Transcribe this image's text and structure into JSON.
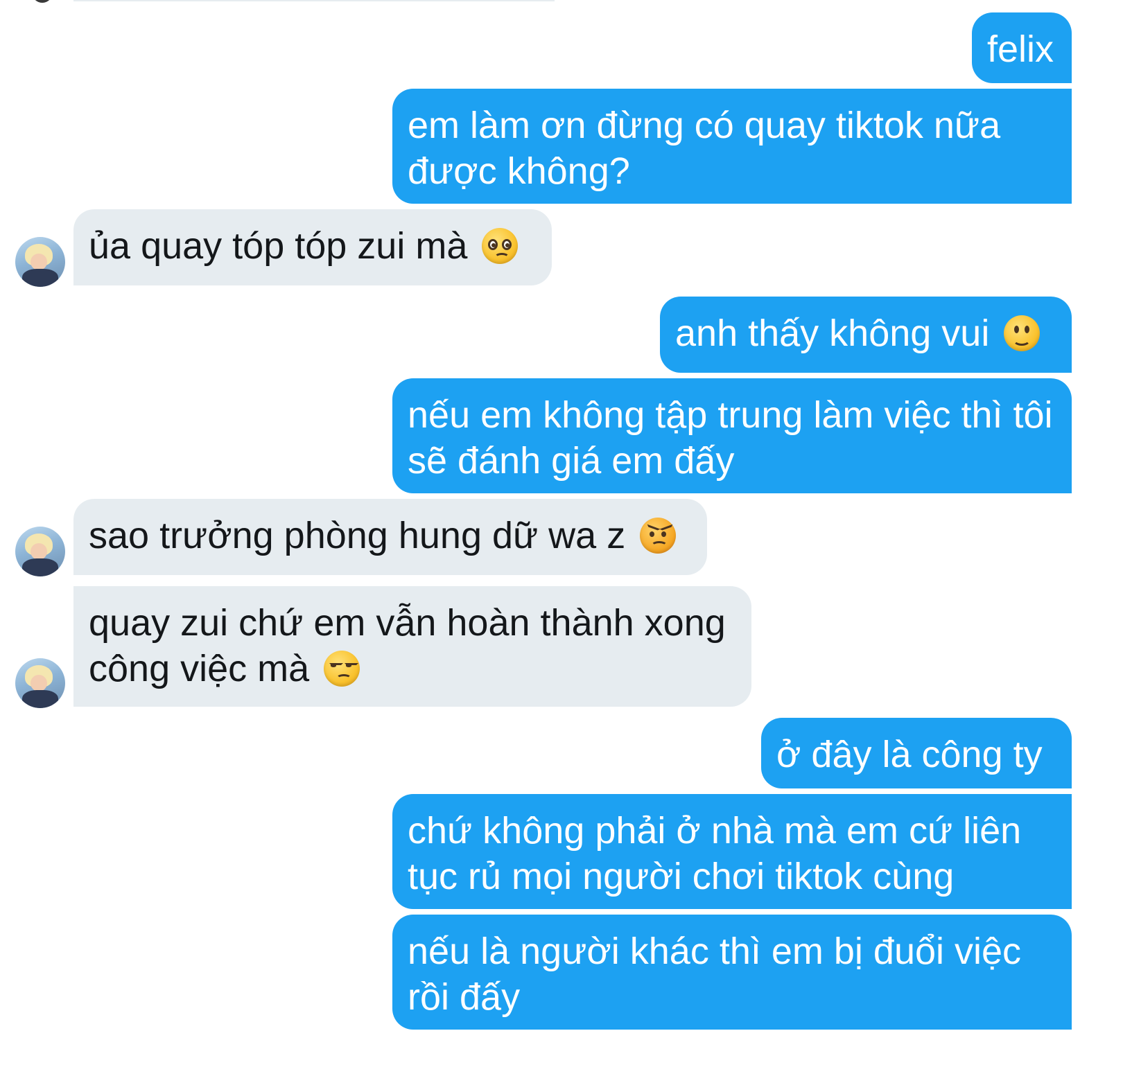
{
  "conversation": {
    "messages": [
      {
        "side": "out",
        "text": "felix",
        "emoji": ""
      },
      {
        "side": "out",
        "text": "em làm ơn đừng có quay tiktok nữa được không?",
        "emoji": ""
      },
      {
        "side": "in",
        "text": "ủa quay tóp tóp zui mà",
        "emoji": "pleading-face"
      },
      {
        "side": "out",
        "text": "anh thấy không vui",
        "emoji": "slightly-smiling-face"
      },
      {
        "side": "out",
        "text": "nếu em không tập trung làm việc thì tôi sẽ đánh giá em đấy",
        "emoji": ""
      },
      {
        "side": "in",
        "text": "sao trưởng phòng hung dữ wa z",
        "emoji": "angry-face"
      },
      {
        "side": "in",
        "text": "quay zui chứ em vẫn hoàn thành xong công việc mà",
        "emoji": "unamused-face"
      },
      {
        "side": "out",
        "text": "ở đây là công ty",
        "emoji": ""
      },
      {
        "side": "out",
        "text": "chứ không phải ở nhà mà em cứ liên tục rủ mọi người chơi tiktok cùng",
        "emoji": ""
      },
      {
        "side": "out",
        "text": "nếu là người khác thì em bị đuổi việc rồi đấy",
        "emoji": ""
      }
    ]
  },
  "colors": {
    "outgoing_bubble": "#1da1f2",
    "incoming_bubble": "#e6ecf0",
    "incoming_text": "#14171a",
    "outgoing_text": "#ffffff"
  }
}
